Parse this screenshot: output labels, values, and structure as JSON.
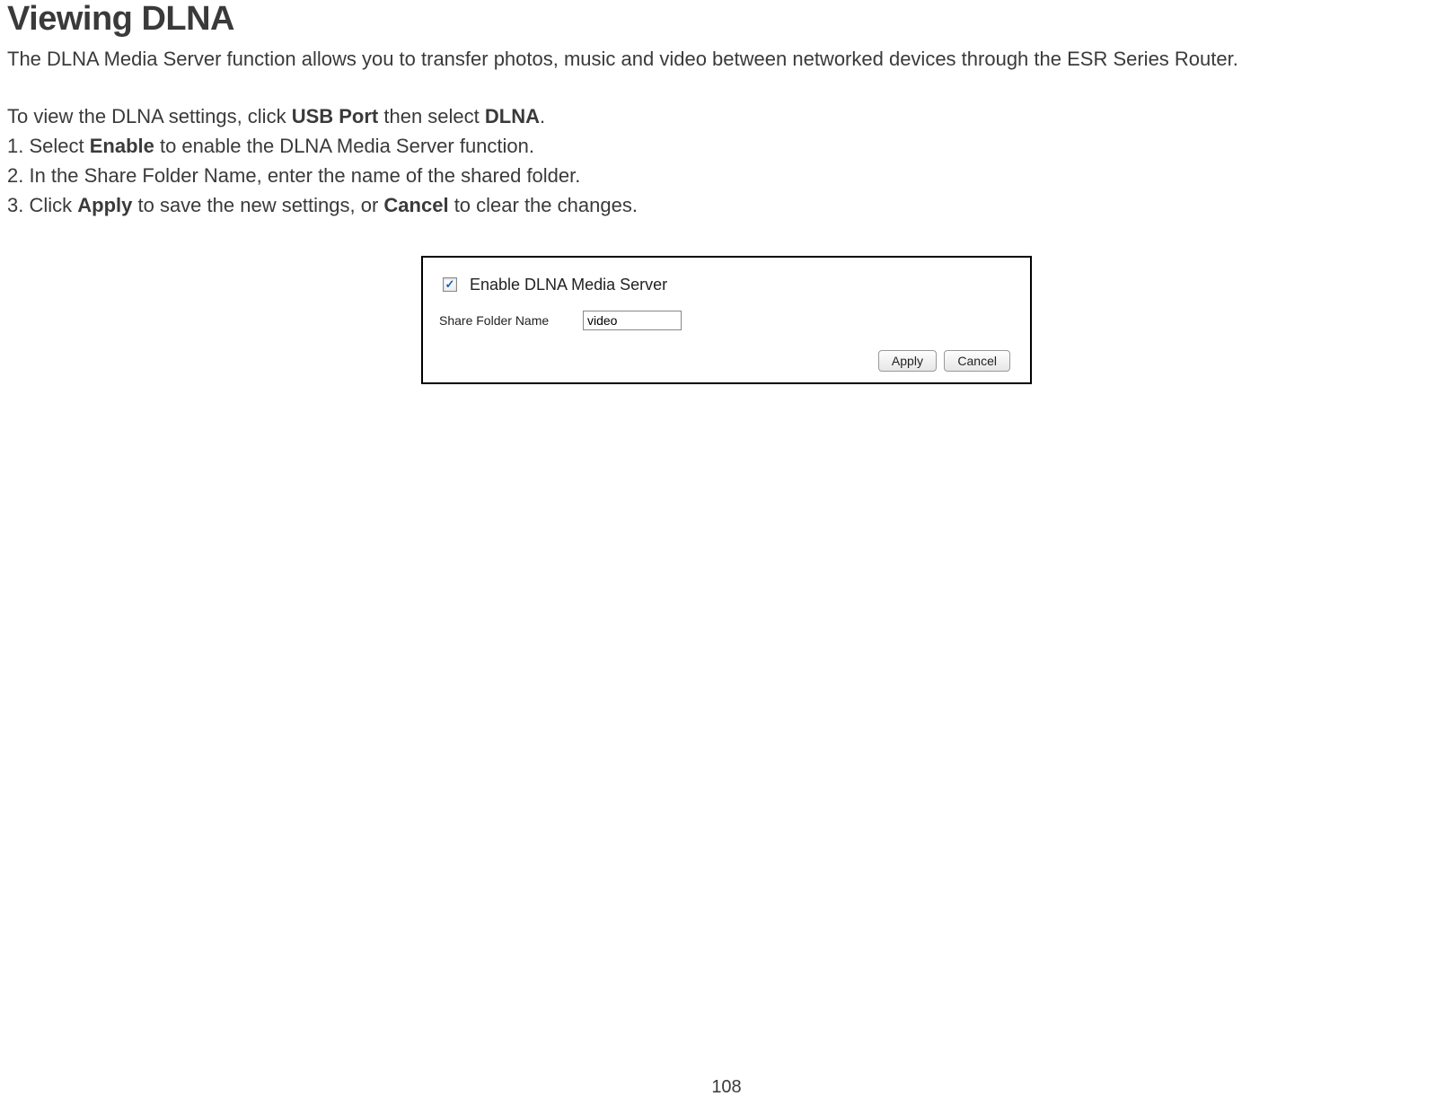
{
  "page": {
    "title": "Viewing DLNA",
    "intro": "The DLNA Media Server function allows you to transfer photos, music and video between networked devices through the ESR Series Router.",
    "view_settings_prefix": "To view the DLNA settings, click ",
    "view_settings_mid": " then select ",
    "view_settings_suffix": ".",
    "usb_port": "USB Port",
    "dlna": "DLNA",
    "step1_prefix": "1. Select ",
    "step1_bold": "Enable",
    "step1_suffix": " to enable the DLNA Media Server function.",
    "step2": "2. In the Share Folder Name, enter the name of the shared folder.",
    "step3_prefix": "3. Click ",
    "step3_bold1": "Apply",
    "step3_mid": " to save the new settings, or ",
    "step3_bold2": "Cancel",
    "step3_suffix": " to clear the changes.",
    "page_number": "108"
  },
  "panel": {
    "checkbox_checked": true,
    "checkbox_label": "Enable DLNA Media Server",
    "input_label": "Share Folder Name",
    "input_value": "video",
    "apply_label": "Apply",
    "cancel_label": "Cancel"
  }
}
